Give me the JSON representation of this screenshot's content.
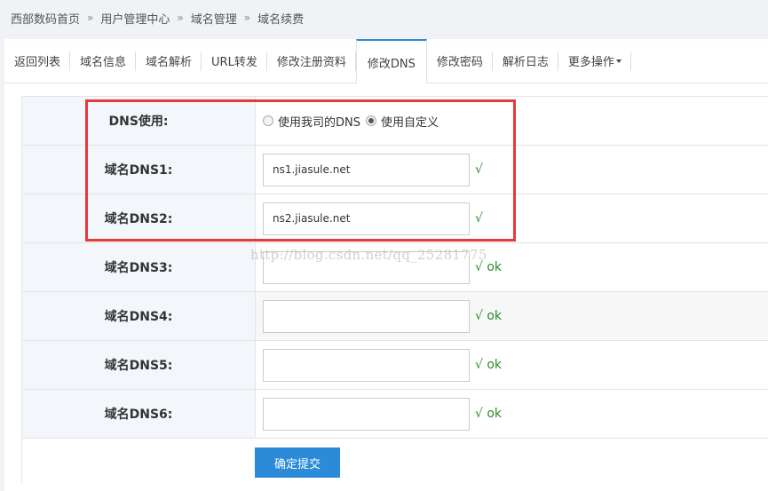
{
  "breadcrumb": {
    "items": [
      "西部数码首页",
      "用户管理中心",
      "域名管理",
      "域名续费"
    ],
    "separator": "»"
  },
  "tabs": [
    {
      "label": "返回列表"
    },
    {
      "label": "域名信息"
    },
    {
      "label": "域名解析"
    },
    {
      "label": "URL转发"
    },
    {
      "label": "修改注册资料"
    },
    {
      "label": "修改DNS",
      "active": true
    },
    {
      "label": "修改密码"
    },
    {
      "label": "解析日志"
    },
    {
      "label": "更多操作",
      "has_dropdown": true
    }
  ],
  "form": {
    "dns_use_label": "DNS使用:",
    "option_ours": "使用我司的DNS",
    "option_custom": "使用自定义",
    "selected_option": "custom",
    "rows": [
      {
        "label": "域名DNS1:",
        "value": "ns1.jiasule.net",
        "status": "√"
      },
      {
        "label": "域名DNS2:",
        "value": "ns2.jiasule.net",
        "status": "√"
      },
      {
        "label": "域名DNS3:",
        "value": "",
        "status": "√ ok"
      },
      {
        "label": "域名DNS4:",
        "value": "",
        "status": "√ ok"
      },
      {
        "label": "域名DNS5:",
        "value": "",
        "status": "√ ok"
      },
      {
        "label": "域名DNS6:",
        "value": "",
        "status": "√ ok"
      }
    ],
    "submit_label": "确定提交"
  },
  "watermark": "http://blog.csdn.net/qq_25281775",
  "colors": {
    "accent": "#2b8bd8",
    "highlight_border": "#e63939",
    "ok_text": "#2a8a2a"
  }
}
